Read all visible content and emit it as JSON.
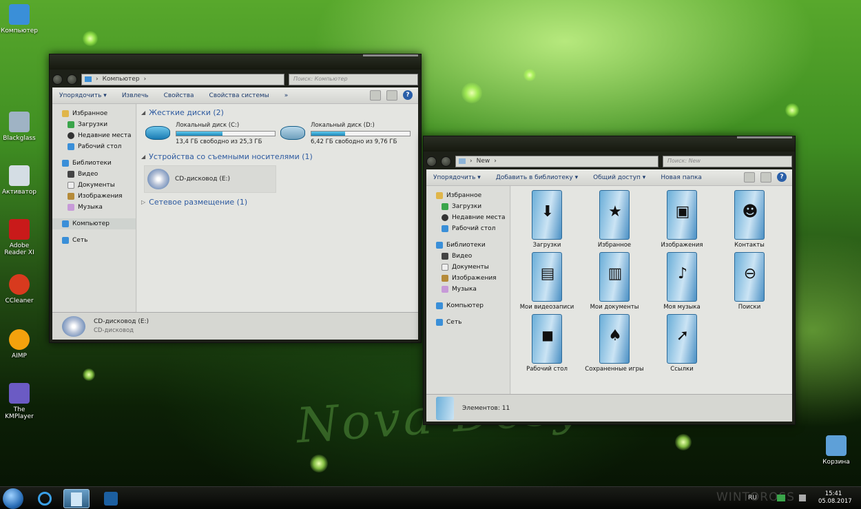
{
  "desktop": {
    "watermark": "Nova Desyre",
    "icons": [
      {
        "label": "Компьютер",
        "color": "#3a8fd8"
      },
      {
        "label": "Blackglass",
        "color": "#9fb3c4"
      },
      {
        "label": "Активатор",
        "color": "#d4dde4"
      },
      {
        "label": "Adobe Reader XI",
        "color": "#c91a1a"
      },
      {
        "label": "CCleaner",
        "color": "#d83a1e"
      },
      {
        "label": "AIMP",
        "color": "#f3a10d"
      },
      {
        "label": "The KMPlayer",
        "color": "#6b5bc4"
      },
      {
        "label": "Корзина",
        "color": "#5ea0d8"
      }
    ]
  },
  "win1": {
    "address": "Компьютер",
    "search_placeholder": "Поиск: Компьютер",
    "toolbar": [
      "Упорядочить ▾",
      "Извлечь",
      "Свойства",
      "Свойства системы",
      "»"
    ],
    "nav": {
      "favorites": "Избранное",
      "fav_items": [
        "Загрузки",
        "Недавние места",
        "Рабочий стол"
      ],
      "libraries": "Библиотеки",
      "lib_items": [
        "Видео",
        "Документы",
        "Изображения",
        "Музыка"
      ],
      "computer": "Компьютер",
      "network": "Сеть"
    },
    "group_hdd": "Жесткие диски (2)",
    "drives": [
      {
        "name": "Локальный диск (C:)",
        "free": "13,4 ГБ свободно из 25,3 ГБ",
        "used": 0.47
      },
      {
        "name": "Локальный диск (D:)",
        "free": "6,42 ГБ свободно из 9,76 ГБ",
        "used": 0.34
      }
    ],
    "group_removable": "Устройства со съемными носителями (1)",
    "cd": "CD-дисковод (E:)",
    "group_network": "Сетевое размещение (1)",
    "status_title": "CD-дисковод (E:)",
    "status_sub": "CD-дисковод"
  },
  "win2": {
    "address": "New",
    "search_placeholder": "Поиск: New",
    "toolbar": [
      "Упорядочить ▾",
      "Добавить в библиотеку ▾",
      "Общий доступ ▾",
      "Новая папка"
    ],
    "nav": {
      "favorites": "Избранное",
      "fav_items": [
        "Загрузки",
        "Недавние места",
        "Рабочий стол"
      ],
      "libraries": "Библиотеки",
      "lib_items": [
        "Видео",
        "Документы",
        "Изображения",
        "Музыка"
      ],
      "computer": "Компьютер",
      "network": "Сеть"
    },
    "folders": [
      {
        "label": "Загрузки",
        "glyph": "⬇"
      },
      {
        "label": "Избранное",
        "glyph": "★"
      },
      {
        "label": "Изображения",
        "glyph": "▣"
      },
      {
        "label": "Контакты",
        "glyph": "☻"
      },
      {
        "label": "Мои видеозаписи",
        "glyph": "▤"
      },
      {
        "label": "Мои документы",
        "glyph": "▥"
      },
      {
        "label": "Моя музыка",
        "glyph": "♪"
      },
      {
        "label": "Поиски",
        "glyph": "⊖"
      },
      {
        "label": "Рабочий стол",
        "glyph": "◼"
      },
      {
        "label": "Сохраненные игры",
        "glyph": "♠"
      },
      {
        "label": "Ссылки",
        "glyph": "➚"
      }
    ],
    "status": "Элементов: 11"
  },
  "tray": {
    "lang": "RU",
    "time": "15:41",
    "date": "05.08.2017",
    "brand": "WINTOROSS"
  }
}
